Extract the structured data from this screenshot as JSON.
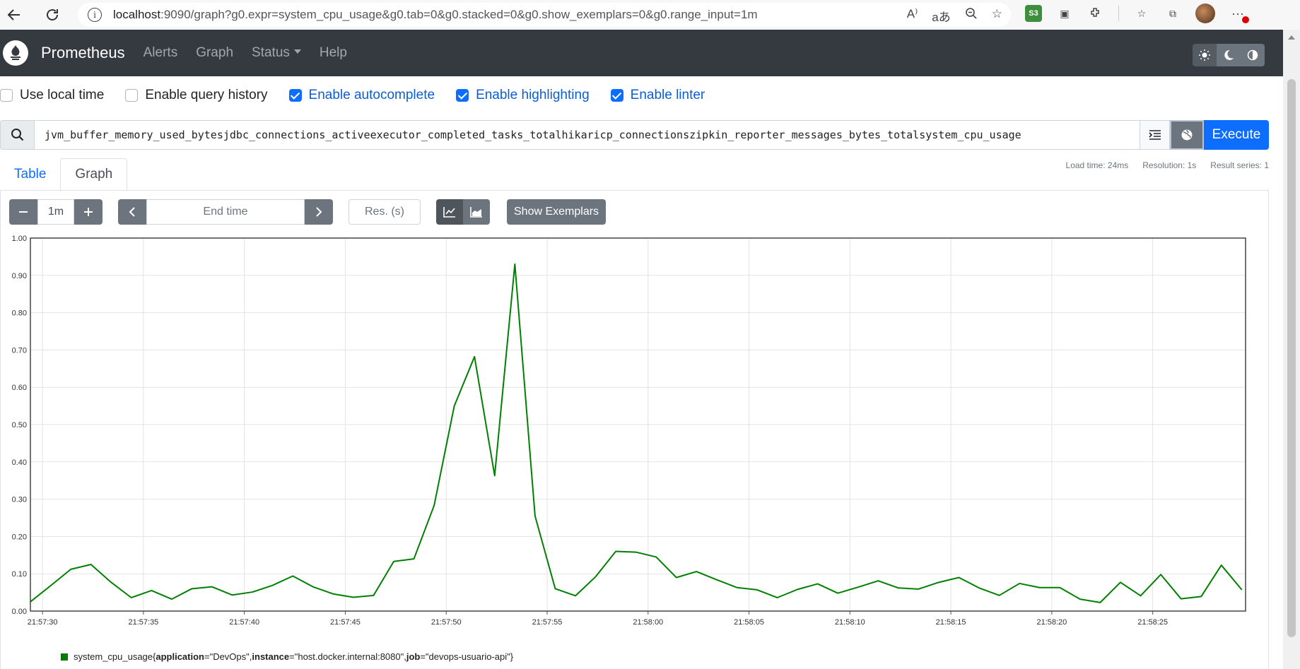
{
  "browser": {
    "url_host": "localhost",
    "url_rest": ":9090/graph?g0.expr=system_cpu_usage&g0.tab=0&g0.stacked=0&g0.show_exemplars=0&g0.range_input=1m"
  },
  "navbar": {
    "brand": "Prometheus",
    "links": [
      "Alerts",
      "Graph",
      "Status",
      "Help"
    ]
  },
  "options": [
    {
      "label": "Use local time",
      "checked": false
    },
    {
      "label": "Enable query history",
      "checked": false
    },
    {
      "label": "Enable autocomplete",
      "checked": true
    },
    {
      "label": "Enable highlighting",
      "checked": true
    },
    {
      "label": "Enable linter",
      "checked": true
    }
  ],
  "query": {
    "expression": "jvm_buffer_memory_used_bytesjdbc_connections_activeexecutor_completed_tasks_totalhikaricp_connectionszipkin_reporter_messages_bytes_totalsystem_cpu_usage",
    "execute_label": "Execute"
  },
  "tabs": [
    {
      "label": "Table",
      "active": false
    },
    {
      "label": "Graph",
      "active": true
    }
  ],
  "stats": {
    "load_time": "Load time: 24ms",
    "resolution": "Resolution: 1s",
    "result_series": "Result series: 1"
  },
  "controls": {
    "range": "1m",
    "end_time_placeholder": "End time",
    "res_placeholder": "Res. (s)",
    "show_exemplars_label": "Show Exemplars"
  },
  "chart_data": {
    "type": "line",
    "ylim": [
      0,
      1
    ],
    "y_ticks": [
      "0.00",
      "0.10",
      "0.20",
      "0.30",
      "0.40",
      "0.50",
      "0.60",
      "0.70",
      "0.80",
      "0.90",
      "1.00"
    ],
    "x_ticks": [
      "21:57:30",
      "21:57:35",
      "21:57:40",
      "21:57:45",
      "21:57:50",
      "21:57:55",
      "21:58:00",
      "21:58:05",
      "21:58:10",
      "21:58:15",
      "21:58:20",
      "21:58:25"
    ],
    "x_range_seconds": [
      0,
      60.2
    ],
    "grid": true,
    "series": [
      {
        "name": "system_cpu_usage",
        "color": "#008000",
        "x": [
          0,
          1,
          2,
          3,
          4,
          5,
          6,
          7,
          8,
          9,
          10,
          11,
          12,
          13,
          14,
          15,
          16,
          17,
          18,
          19,
          20,
          21,
          22,
          23,
          24,
          25,
          26,
          27,
          28,
          29,
          30,
          31,
          32,
          33,
          34,
          35,
          36,
          37,
          38,
          39,
          40,
          41,
          42,
          43,
          44,
          45,
          46,
          47,
          48,
          49,
          50,
          51,
          52,
          53,
          54,
          55,
          56,
          57,
          58,
          59,
          60
        ],
        "values": [
          0.025,
          0.068,
          0.112,
          0.125,
          0.077,
          0.036,
          0.055,
          0.032,
          0.06,
          0.065,
          0.043,
          0.051,
          0.069,
          0.094,
          0.065,
          0.046,
          0.037,
          0.042,
          0.133,
          0.14,
          0.283,
          0.55,
          0.682,
          0.363,
          0.93,
          0.255,
          0.06,
          0.041,
          0.092,
          0.16,
          0.158,
          0.145,
          0.09,
          0.106,
          0.084,
          0.063,
          0.057,
          0.036,
          0.058,
          0.073,
          0.048,
          0.064,
          0.081,
          0.062,
          0.059,
          0.077,
          0.09,
          0.062,
          0.042,
          0.074,
          0.063,
          0.063,
          0.032,
          0.023,
          0.077,
          0.041,
          0.098,
          0.033,
          0.039,
          0.123,
          0.058
        ]
      }
    ]
  },
  "legend": {
    "metric": "system_cpu_usage",
    "open": "{",
    "k1": "application",
    "v1": "=\"DevOps\", ",
    "k2": "instance",
    "v2": "=\"host.docker.internal:8080\", ",
    "k3": "job",
    "v3": "=\"devops-usuario-api\"",
    "close": "}"
  }
}
